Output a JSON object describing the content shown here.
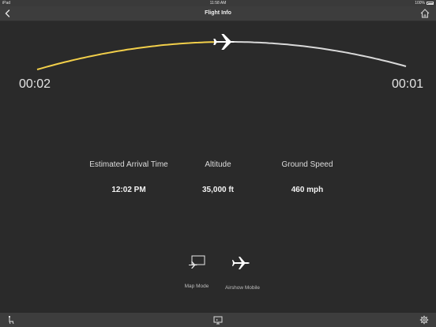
{
  "status_bar": {
    "carrier": "iPad",
    "time": "11:58 AM",
    "battery": "100%"
  },
  "nav": {
    "title": "Flight Info"
  },
  "progress": {
    "fraction": 0.5
  },
  "times": {
    "elapsed": "00:02",
    "remaining": "00:01"
  },
  "stats": [
    {
      "label": "Estimated Arrival Time",
      "value": "12:02 PM"
    },
    {
      "label": "Altitude",
      "value": "35,000 ft"
    },
    {
      "label": "Ground Speed",
      "value": "460 mph"
    }
  ],
  "modes": [
    {
      "label": "Map Mode",
      "icon": "map-mode-icon"
    },
    {
      "label": "Airshow Mobile",
      "icon": "airplane-icon"
    }
  ],
  "colors": {
    "progress_accent": "#f2cf4a",
    "remaining_track": "#d9d9d9",
    "background": "#2a2a2a"
  }
}
